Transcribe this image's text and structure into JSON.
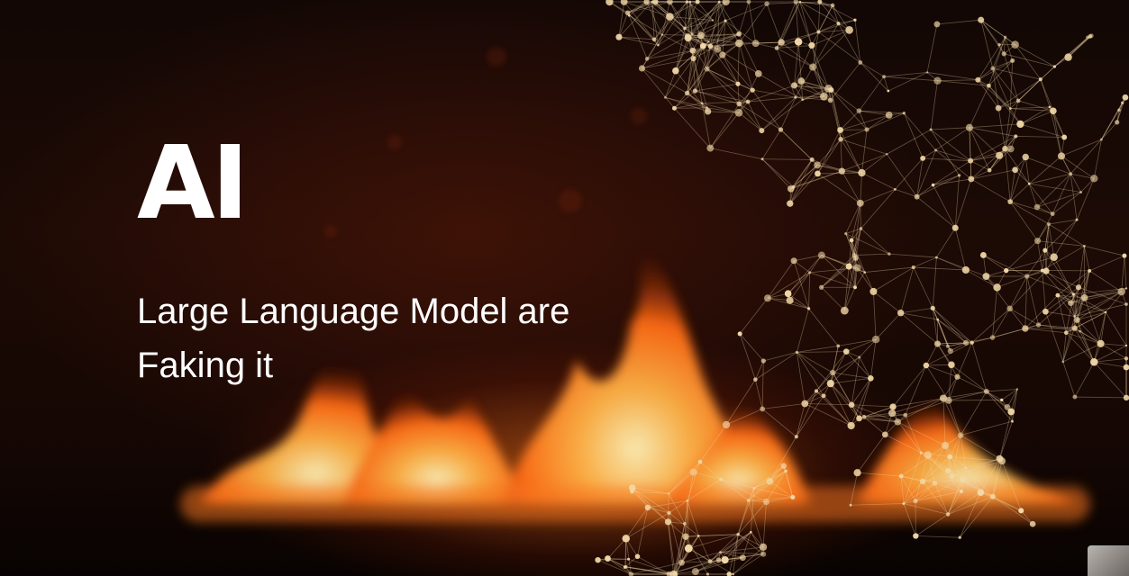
{
  "headline": "AI",
  "subtitle": {
    "line1": "Large Language Model are",
    "line2": "Faking it"
  },
  "colors": {
    "background": "#120705",
    "fire": "#ff8a2a",
    "network": "#f3d9a8",
    "text": "#ffffff"
  }
}
